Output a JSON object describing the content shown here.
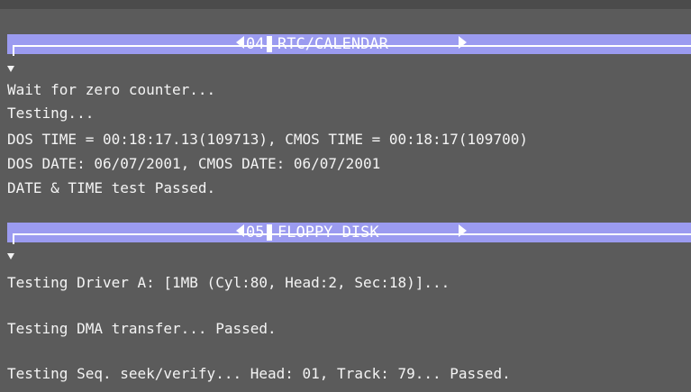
{
  "sections": [
    {
      "number": "04",
      "title": "RTC/CALENDAR",
      "lines": [
        "Wait for zero counter...",
        "Testing...",
        "DOS TIME = 00:18:17.13(109713), CMOS TIME = 00:18:17(109700)",
        "DOS DATE: 06/07/2001, CMOS DATE: 06/07/2001",
        "DATE & TIME test Passed."
      ]
    },
    {
      "number": "05",
      "title": "FLOPPY DISK",
      "lines": [
        "Testing Driver A: [1MB (Cyl:80, Head:2, Sec:18)]...",
        "Testing DMA transfer... Passed.",
        "Testing Seq. seek/verify... Head: 01, Track: 79... Passed."
      ]
    }
  ],
  "colors": {
    "background": "#5b5b5b",
    "section_bar": "#9b9bf0",
    "text": "#f4f4f4"
  }
}
